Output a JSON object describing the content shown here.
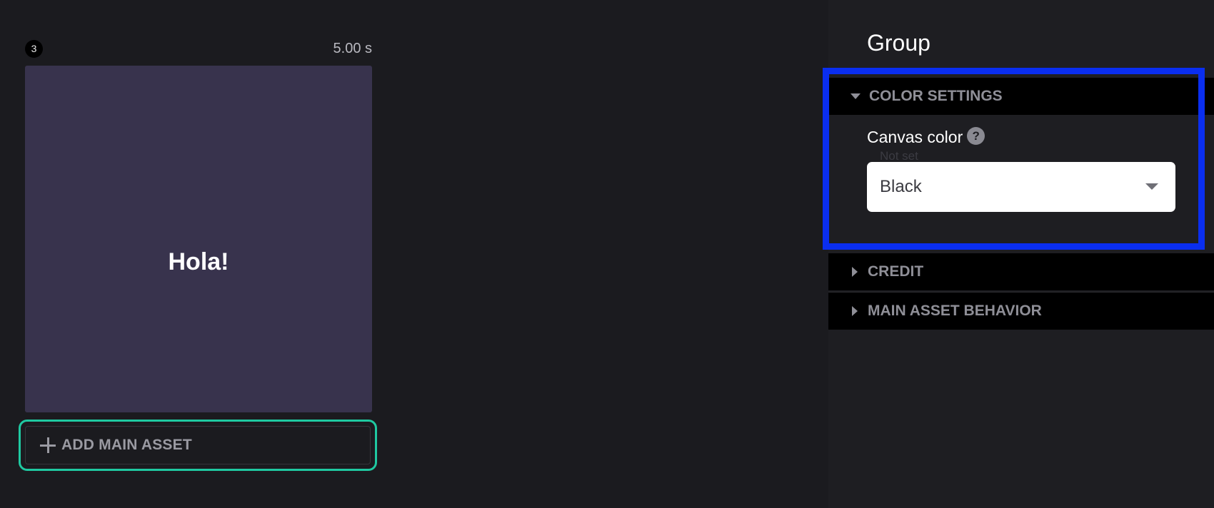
{
  "scene": {
    "index": "3",
    "duration": "5.00 s",
    "preview_text": "Hola!",
    "add_asset_label": "ADD MAIN ASSET"
  },
  "panel": {
    "title": "Group",
    "sections": {
      "color_settings": {
        "title": "COLOR SETTINGS",
        "expanded": true,
        "canvas_color": {
          "label": "Canvas color",
          "help_glyph": "?",
          "hint": "Not set",
          "value": "Black"
        }
      },
      "credit": {
        "title": "CREDIT",
        "expanded": false
      },
      "main_asset_behavior": {
        "title": "MAIN ASSET BEHAVIOR",
        "expanded": false
      }
    }
  },
  "colors": {
    "background": "#1b1b1f",
    "preview": "#38334d",
    "focus_ring": "#1fc9a1",
    "highlight": "#0a2ef0"
  },
  "icons": {
    "add": "plus-icon",
    "expanded": "caret-down-icon",
    "collapsed": "caret-right-icon",
    "help": "help-icon",
    "select": "chevron-down-icon"
  }
}
